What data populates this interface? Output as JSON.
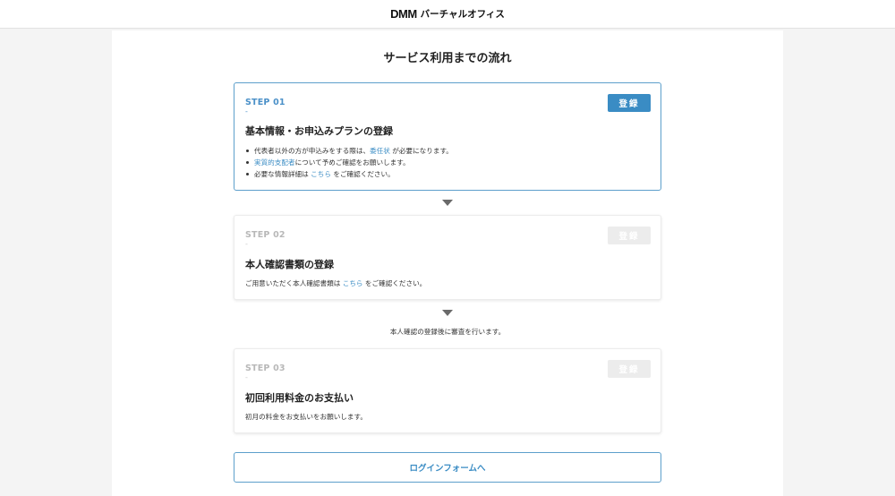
{
  "header": {
    "logo_mark": "DMM",
    "logo_text": "バーチャルオフィス"
  },
  "page": {
    "title": "サービス利用までの流れ"
  },
  "steps": [
    {
      "step_label": "STEP 01",
      "dash": "-",
      "button_label": "登録",
      "title": "基本情報・お申込みプランの登録",
      "bullets": [
        {
          "before": "代表者以外の方が申込みをする際は、",
          "link": "委任状",
          "after": " が必要になります。"
        },
        {
          "before": "",
          "link": "実質的支配者",
          "after": "について予めご確認をお願いします。"
        },
        {
          "before": "必要な情報詳細は ",
          "link": "こちら",
          "after": " をご確認ください。"
        }
      ]
    },
    {
      "step_label": "STEP 02",
      "dash": "-",
      "button_label": "登録",
      "title": "本人確認書類の登録",
      "line": {
        "before": "ご用意いただく本人確認書類は ",
        "link": "こちら",
        "after": " をご確認ください。"
      }
    },
    {
      "step_label": "STEP 03",
      "dash": "-",
      "button_label": "登録",
      "title": "初回利用料金のお支払い",
      "line": {
        "before": "初月の料金をお支払いをお願いします。"
      }
    }
  ],
  "review_note": "本人確認の登録後に審査を行います。",
  "login_button": "ログインフォームへ"
}
